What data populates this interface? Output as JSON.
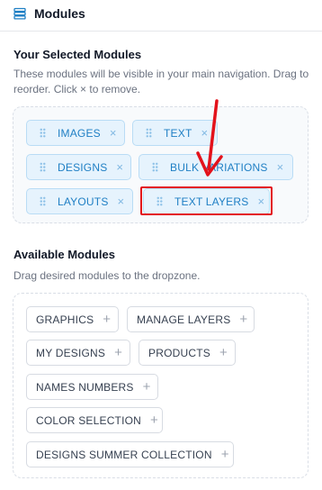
{
  "header": {
    "title": "Modules",
    "icon": "layers-list-icon"
  },
  "selected": {
    "title": "Your Selected Modules",
    "description": "These modules will be visible in your main navigation. Drag to reorder. Click × to remove.",
    "remove_glyph": "×",
    "modules": [
      "IMAGES",
      "TEXT",
      "DESIGNS",
      "BULK VARIATIONS",
      "LAYOUTS",
      "TEXT LAYERS"
    ]
  },
  "available": {
    "title": "Available Modules",
    "description": "Drag desired modules to the dropzone.",
    "add_glyph": "+",
    "modules": [
      "GRAPHICS",
      "MANAGE LAYERS",
      "MY DESIGNS",
      "PRODUCTS",
      "NAMES NUMBERS",
      "COLOR SELECTION",
      "DESIGNS SUMMER COLLECTION"
    ]
  },
  "annotation": {
    "color": "#e3121b",
    "highlighted_module": "TEXT LAYERS"
  },
  "colors": {
    "selected_chip_bg": "#e6f3fd",
    "selected_chip_text": "#1f7fc4",
    "accent": "#1f7fc4"
  }
}
